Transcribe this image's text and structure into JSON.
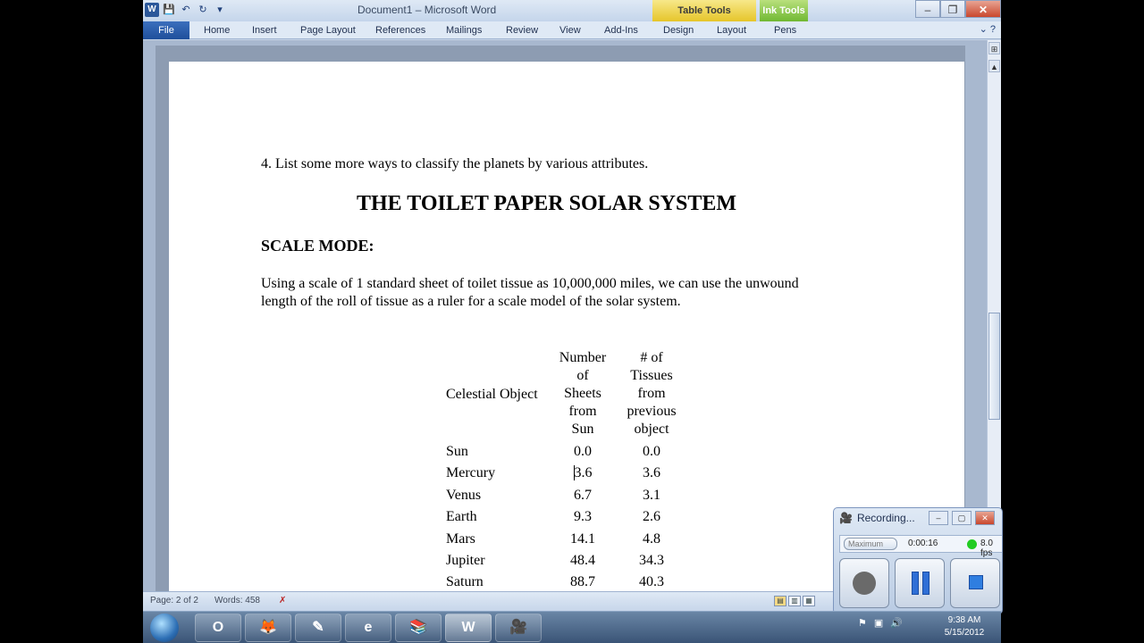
{
  "titlebar": {
    "title": "Document1 – Microsoft Word",
    "context_tabs": [
      "Table Tools",
      "Ink Tools"
    ]
  },
  "ribbon": {
    "file_tab": "File",
    "tabs": [
      "Home",
      "Insert",
      "Page Layout",
      "References",
      "Mailings",
      "Review",
      "View",
      "Add-Ins",
      "Design",
      "Layout",
      "Pens"
    ]
  },
  "document": {
    "question": "4. List some more ways to classify the planets by various attributes.",
    "title": "THE TOILET PAPER SOLAR SYSTEM",
    "heading": "SCALE MODE:",
    "paragraph_line1": "Using a scale of 1 standard sheet of toilet tissue as 10,000,000 miles, we can use the unwound",
    "paragraph_line2": "length of the roll of tissue as a ruler for a scale model of the solar system.",
    "table": {
      "headers": [
        "Celestial  Object",
        "Number of Sheets from Sun",
        "# of Tissues from previous object"
      ],
      "header_lines_col2": [
        "Number",
        "of",
        "Sheets",
        "from",
        "Sun"
      ],
      "header_lines_col3": [
        "# of",
        "Tissues",
        "from",
        "previous",
        "object"
      ],
      "rows": [
        {
          "object": "Sun",
          "sheets": "0.0",
          "tissues": "0.0"
        },
        {
          "object": "Mercury",
          "sheets": "3.6",
          "tissues": "3.6"
        },
        {
          "object": "Venus",
          "sheets": "6.7",
          "tissues": "3.1"
        },
        {
          "object": "Earth",
          "sheets": "9.3",
          "tissues": "2.6"
        },
        {
          "object": "Mars",
          "sheets": "14.1",
          "tissues": "4.8"
        },
        {
          "object": "Jupiter",
          "sheets": "48.4",
          "tissues": "34.3"
        },
        {
          "object": "Saturn",
          "sheets": "88.7",
          "tissues": "40.3"
        }
      ]
    }
  },
  "statusbar": {
    "page": "Page: 2 of 2",
    "words": "Words: 458"
  },
  "recorder": {
    "title": "Recording...",
    "select": "Maximum",
    "time": "0:00:16",
    "rate": "8.0 fps"
  },
  "taskbar": {
    "time": "9:38 AM",
    "date": "5/15/2012"
  }
}
